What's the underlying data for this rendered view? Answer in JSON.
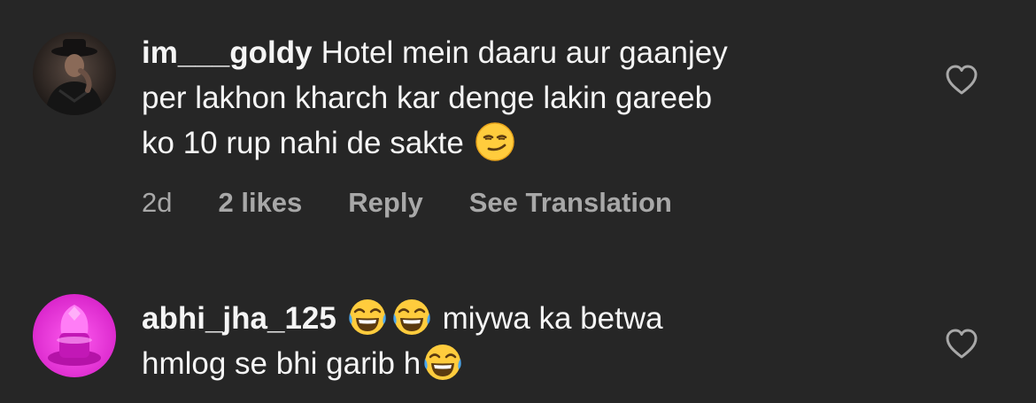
{
  "comments": [
    {
      "username": "im___goldy",
      "text_lines": [
        "Hotel mein daaru aur gaanjey",
        "per lakhon kharch kar denge lakin gareeb",
        "ko 10 rup nahi de sakte"
      ],
      "emoji": "smirking-face",
      "age": "2d",
      "likes": "2 likes",
      "reply_label": "Reply",
      "translate_label": "See Translation",
      "avatar_icon": "man-in-hat-avatar",
      "like_icon": "heart-outline-icon"
    },
    {
      "username": "abhi_jha_125",
      "text_part1": "miywa ka betwa",
      "text_part2": "hmlog se bhi garib h",
      "emoji": "face-with-tears-of-joy",
      "avatar_icon": "pink-shivling-avatar",
      "like_icon": "heart-outline-icon"
    }
  ],
  "colors": {
    "background": "#262626",
    "text": "#f5f5f5",
    "meta": "#a8a8a8"
  }
}
